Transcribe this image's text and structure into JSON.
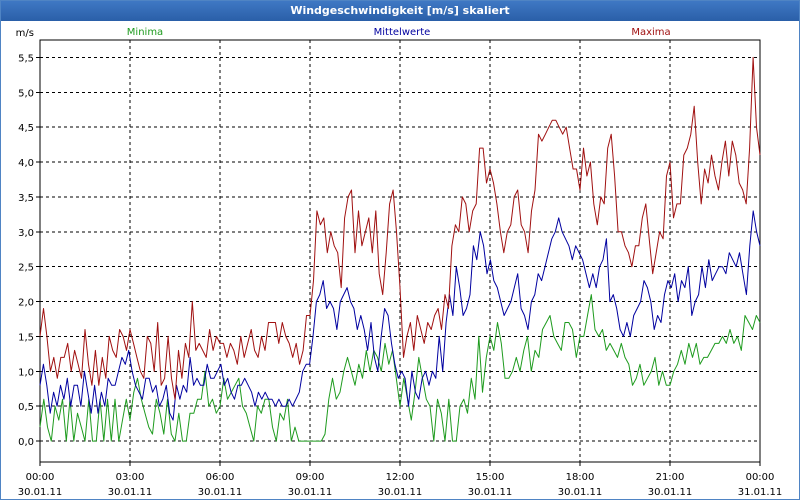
{
  "window": {
    "title": "Windgeschwindigkeit [m/s] skaliert"
  },
  "colors": {
    "min": "#1e9b1e",
    "mean": "#0000a0",
    "max": "#a01010",
    "grid": "#000000"
  },
  "chart_data": {
    "type": "line",
    "title": "Windgeschwindigkeit [m/s] skaliert",
    "ylabel": "m/s",
    "ylim": [
      -0.3,
      5.75
    ],
    "xlim": [
      0,
      24
    ],
    "yticks": [
      "0,0",
      "0,5",
      "1,0",
      "1,5",
      "2,0",
      "2,5",
      "3,0",
      "3,5",
      "4,0",
      "4,5",
      "5,0",
      "5,5"
    ],
    "xticks": [
      {
        "time": "00:00",
        "date": "30.01.11"
      },
      {
        "time": "03:00",
        "date": "30.01.11"
      },
      {
        "time": "06:00",
        "date": "30.01.11"
      },
      {
        "time": "09:00",
        "date": "30.01.11"
      },
      {
        "time": "12:00",
        "date": "30.01.11"
      },
      {
        "time": "15:00",
        "date": "30.01.11"
      },
      {
        "time": "18:00",
        "date": "30.01.11"
      },
      {
        "time": "21:00",
        "date": "30.01.11"
      },
      {
        "time": "00:00",
        "date": "31.01.11"
      }
    ],
    "grid": true,
    "legend": [
      "Minima",
      "Mittelwerte",
      "Maxima"
    ],
    "series": [
      {
        "name": "Minima",
        "values": [
          0.2,
          0.6,
          0.2,
          0.0,
          0.5,
          0.3,
          0.6,
          0.0,
          0.6,
          0.0,
          0.4,
          0.2,
          0.0,
          0.6,
          0.0,
          0.0,
          0.6,
          0.0,
          0.6,
          0.0,
          0.6,
          0.0,
          0.3,
          0.6,
          0.3,
          0.7,
          0.9,
          0.6,
          0.4,
          0.2,
          0.1,
          0.6,
          0.4,
          0.1,
          0.6,
          0.1,
          0.0,
          0.4,
          0.0,
          0.0,
          0.4,
          0.4,
          0.6,
          0.6,
          1.0,
          0.5,
          0.6,
          0.4,
          0.5,
          0.9,
          0.6,
          0.7,
          0.8,
          0.9,
          0.5,
          0.4,
          0.2,
          0.0,
          0.5,
          0.4,
          0.6,
          0.6,
          0.2,
          0.0,
          0.4,
          0.3,
          0.6,
          0.0,
          0.2,
          0.0,
          0.0,
          0.0,
          0.0,
          0.0,
          0.0,
          0.0,
          0.1,
          0.6,
          0.9,
          0.6,
          0.7,
          1.0,
          1.2,
          1.0,
          0.8,
          1.1,
          0.9,
          1.3,
          1.0,
          1.3,
          1.2,
          1.0,
          1.4,
          1.1,
          1.3,
          0.9,
          0.5,
          0.9,
          0.6,
          0.3,
          0.7,
          1.2,
          0.9,
          0.6,
          0.5,
          0.0,
          0.6,
          0.4,
          0.0,
          0.6,
          0.0,
          0.0,
          0.5,
          0.6,
          0.4,
          0.9,
          0.6,
          1.5,
          0.7,
          1.2,
          1.5,
          1.3,
          1.7,
          1.4,
          0.9,
          0.9,
          1.0,
          1.2,
          1.0,
          1.3,
          1.5,
          1.0,
          1.3,
          1.2,
          1.6,
          1.7,
          1.8,
          1.5,
          1.4,
          1.3,
          1.7,
          1.7,
          1.6,
          1.2,
          1.5,
          1.5,
          1.8,
          2.1,
          1.6,
          1.5,
          1.6,
          1.3,
          1.4,
          1.3,
          1.2,
          1.4,
          1.2,
          1.1,
          0.8,
          0.9,
          1.1,
          0.8,
          0.9,
          1.0,
          1.2,
          0.8,
          1.0,
          0.8,
          0.8,
          1.0,
          1.1,
          1.3,
          1.1,
          1.4,
          1.2,
          1.4,
          1.1,
          1.2,
          1.2,
          1.3,
          1.4,
          1.4,
          1.5,
          1.4,
          1.6,
          1.4,
          1.5,
          1.3,
          1.8,
          1.7,
          1.6,
          1.8,
          1.7
        ]
      },
      {
        "name": "Mittelwerte",
        "values": [
          0.8,
          1.1,
          0.8,
          0.4,
          0.7,
          0.5,
          0.8,
          0.6,
          0.9,
          0.5,
          0.8,
          0.8,
          0.5,
          1.0,
          0.7,
          0.4,
          0.8,
          0.4,
          0.7,
          0.5,
          0.9,
          0.8,
          0.8,
          1.0,
          1.2,
          1.1,
          1.3,
          1.0,
          0.8,
          0.7,
          0.6,
          0.9,
          0.9,
          0.7,
          0.8,
          0.5,
          0.6,
          0.8,
          0.4,
          0.3,
          0.8,
          0.6,
          0.8,
          0.7,
          1.2,
          0.8,
          0.9,
          0.8,
          0.8,
          1.1,
          0.9,
          0.9,
          1.0,
          1.1,
          0.8,
          0.9,
          0.7,
          0.6,
          0.8,
          0.8,
          0.9,
          0.8,
          0.7,
          0.5,
          0.7,
          0.6,
          0.7,
          0.6,
          0.6,
          0.5,
          0.6,
          0.5,
          0.5,
          0.6,
          0.5,
          0.6,
          0.7,
          1.0,
          1.1,
          1.1,
          1.5,
          2.0,
          2.1,
          2.3,
          1.9,
          2.0,
          1.9,
          1.6,
          2.0,
          2.1,
          2.2,
          2.0,
          1.9,
          1.6,
          1.8,
          1.6,
          1.3,
          1.7,
          1.2,
          1.0,
          1.5,
          1.9,
          1.8,
          1.4,
          1.1,
          0.9,
          1.0,
          0.9,
          0.5,
          1.0,
          0.7,
          0.6,
          0.9,
          1.0,
          0.8,
          1.0,
          0.9,
          1.5,
          1.0,
          1.7,
          2.1,
          1.8,
          2.5,
          2.2,
          1.8,
          1.9,
          2.1,
          2.8,
          2.6,
          3.0,
          2.8,
          2.4,
          2.6,
          2.3,
          2.2,
          2.0,
          1.8,
          1.9,
          2.0,
          2.2,
          2.4,
          1.9,
          1.8,
          1.6,
          2.0,
          2.1,
          2.4,
          2.3,
          2.5,
          2.7,
          2.9,
          3.0,
          3.2,
          3.0,
          2.9,
          2.8,
          2.6,
          2.8,
          2.7,
          2.6,
          2.4,
          2.2,
          2.4,
          2.2,
          2.5,
          2.6,
          2.9,
          2.0,
          2.1,
          1.9,
          1.6,
          1.5,
          1.7,
          1.5,
          1.8,
          1.9,
          2.0,
          2.3,
          2.2,
          2.0,
          1.6,
          1.8,
          1.7,
          2.1,
          2.3,
          2.2,
          2.4,
          2.0,
          2.3,
          2.2,
          2.5,
          1.8,
          2.0,
          2.1,
          2.5,
          2.2,
          2.6,
          2.3,
          2.4,
          2.5,
          2.5,
          2.4,
          2.7,
          2.6,
          2.5,
          2.7,
          2.4,
          2.1,
          2.8,
          3.3,
          3.0,
          2.8
        ]
      },
      {
        "name": "Maxima",
        "values": [
          1.5,
          1.9,
          1.5,
          1.0,
          1.2,
          0.9,
          1.2,
          1.2,
          1.4,
          1.0,
          1.3,
          1.1,
          0.9,
          1.6,
          1.1,
          0.8,
          1.3,
          0.8,
          1.2,
          0.9,
          1.5,
          1.3,
          1.2,
          1.6,
          1.5,
          1.3,
          1.6,
          1.4,
          1.2,
          1.0,
          0.9,
          1.5,
          1.4,
          1.0,
          1.7,
          0.8,
          0.9,
          1.5,
          0.9,
          0.6,
          1.3,
          0.9,
          1.4,
          1.2,
          2.0,
          1.3,
          1.4,
          1.3,
          1.2,
          1.6,
          1.3,
          1.5,
          1.4,
          1.4,
          1.2,
          1.4,
          1.3,
          1.1,
          1.5,
          1.2,
          1.4,
          1.6,
          1.3,
          1.2,
          1.5,
          1.3,
          1.7,
          1.7,
          1.7,
          1.4,
          1.7,
          1.5,
          1.4,
          1.2,
          1.4,
          1.1,
          1.3,
          1.8,
          1.8,
          2.3,
          3.3,
          3.1,
          3.2,
          2.7,
          3.0,
          2.8,
          2.7,
          2.2,
          3.2,
          3.5,
          3.6,
          2.7,
          3.3,
          2.8,
          3.0,
          3.2,
          2.7,
          3.3,
          2.4,
          2.1,
          2.7,
          3.4,
          3.6,
          3.0,
          2.2,
          1.2,
          1.5,
          1.7,
          1.3,
          1.8,
          1.6,
          1.4,
          1.7,
          1.6,
          1.8,
          1.9,
          1.6,
          2.1,
          1.9,
          2.8,
          3.1,
          3.0,
          3.5,
          3.4,
          3.0,
          3.3,
          3.4,
          4.2,
          4.2,
          3.7,
          3.9,
          3.7,
          3.4,
          3.0,
          2.7,
          3.0,
          3.1,
          3.5,
          3.6,
          3.1,
          3.0,
          2.7,
          3.3,
          3.6,
          4.4,
          4.3,
          4.4,
          4.5,
          4.6,
          4.6,
          4.5,
          4.4,
          4.5,
          4.2,
          3.9,
          3.9,
          3.6,
          4.2,
          3.8,
          4.0,
          3.4,
          3.1,
          3.5,
          3.4,
          4.2,
          4.4,
          3.8,
          3.0,
          3.0,
          2.8,
          2.7,
          2.5,
          2.8,
          2.8,
          3.2,
          3.4,
          2.9,
          2.4,
          2.7,
          3.0,
          2.9,
          3.8,
          4.0,
          3.2,
          3.4,
          3.4,
          4.1,
          4.2,
          4.4,
          4.8,
          4.0,
          3.4,
          3.9,
          3.7,
          4.1,
          3.8,
          3.6,
          4.0,
          4.3,
          3.8,
          4.3,
          4.1,
          3.7,
          3.6,
          3.4,
          4.2,
          5.5,
          4.5,
          4.1
        ]
      }
    ]
  }
}
